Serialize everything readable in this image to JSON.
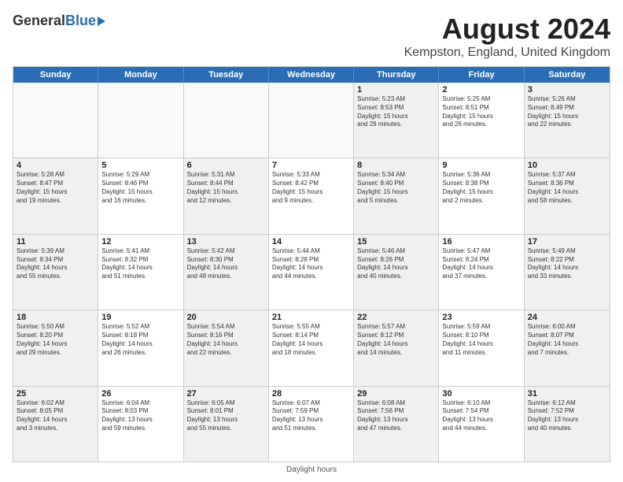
{
  "header": {
    "logo_general": "General",
    "logo_blue": "Blue",
    "main_title": "August 2024",
    "subtitle": "Kempston, England, United Kingdom"
  },
  "footer": {
    "note": "Daylight hours"
  },
  "days_of_week": [
    "Sunday",
    "Monday",
    "Tuesday",
    "Wednesday",
    "Thursday",
    "Friday",
    "Saturday"
  ],
  "weeks": [
    [
      {
        "day": "",
        "info": ""
      },
      {
        "day": "",
        "info": ""
      },
      {
        "day": "",
        "info": ""
      },
      {
        "day": "",
        "info": ""
      },
      {
        "day": "1",
        "info": "Sunrise: 5:23 AM\nSunset: 8:53 PM\nDaylight: 15 hours\nand 29 minutes."
      },
      {
        "day": "2",
        "info": "Sunrise: 5:25 AM\nSunset: 8:51 PM\nDaylight: 15 hours\nand 26 minutes."
      },
      {
        "day": "3",
        "info": "Sunrise: 5:26 AM\nSunset: 8:49 PM\nDaylight: 15 hours\nand 22 minutes."
      }
    ],
    [
      {
        "day": "4",
        "info": "Sunrise: 5:28 AM\nSunset: 8:47 PM\nDaylight: 15 hours\nand 19 minutes."
      },
      {
        "day": "5",
        "info": "Sunrise: 5:29 AM\nSunset: 8:46 PM\nDaylight: 15 hours\nand 16 minutes."
      },
      {
        "day": "6",
        "info": "Sunrise: 5:31 AM\nSunset: 8:44 PM\nDaylight: 15 hours\nand 12 minutes."
      },
      {
        "day": "7",
        "info": "Sunrise: 5:33 AM\nSunset: 8:42 PM\nDaylight: 15 hours\nand 9 minutes."
      },
      {
        "day": "8",
        "info": "Sunrise: 5:34 AM\nSunset: 8:40 PM\nDaylight: 15 hours\nand 5 minutes."
      },
      {
        "day": "9",
        "info": "Sunrise: 5:36 AM\nSunset: 8:38 PM\nDaylight: 15 hours\nand 2 minutes."
      },
      {
        "day": "10",
        "info": "Sunrise: 5:37 AM\nSunset: 8:36 PM\nDaylight: 14 hours\nand 58 minutes."
      }
    ],
    [
      {
        "day": "11",
        "info": "Sunrise: 5:39 AM\nSunset: 8:34 PM\nDaylight: 14 hours\nand 55 minutes."
      },
      {
        "day": "12",
        "info": "Sunrise: 5:41 AM\nSunset: 8:32 PM\nDaylight: 14 hours\nand 51 minutes."
      },
      {
        "day": "13",
        "info": "Sunrise: 5:42 AM\nSunset: 8:30 PM\nDaylight: 14 hours\nand 48 minutes."
      },
      {
        "day": "14",
        "info": "Sunrise: 5:44 AM\nSunset: 8:28 PM\nDaylight: 14 hours\nand 44 minutes."
      },
      {
        "day": "15",
        "info": "Sunrise: 5:46 AM\nSunset: 8:26 PM\nDaylight: 14 hours\nand 40 minutes."
      },
      {
        "day": "16",
        "info": "Sunrise: 5:47 AM\nSunset: 8:24 PM\nDaylight: 14 hours\nand 37 minutes."
      },
      {
        "day": "17",
        "info": "Sunrise: 5:49 AM\nSunset: 8:22 PM\nDaylight: 14 hours\nand 33 minutes."
      }
    ],
    [
      {
        "day": "18",
        "info": "Sunrise: 5:50 AM\nSunset: 8:20 PM\nDaylight: 14 hours\nand 29 minutes."
      },
      {
        "day": "19",
        "info": "Sunrise: 5:52 AM\nSunset: 8:18 PM\nDaylight: 14 hours\nand 26 minutes."
      },
      {
        "day": "20",
        "info": "Sunrise: 5:54 AM\nSunset: 8:16 PM\nDaylight: 14 hours\nand 22 minutes."
      },
      {
        "day": "21",
        "info": "Sunrise: 5:55 AM\nSunset: 8:14 PM\nDaylight: 14 hours\nand 18 minutes."
      },
      {
        "day": "22",
        "info": "Sunrise: 5:57 AM\nSunset: 8:12 PM\nDaylight: 14 hours\nand 14 minutes."
      },
      {
        "day": "23",
        "info": "Sunrise: 5:59 AM\nSunset: 8:10 PM\nDaylight: 14 hours\nand 11 minutes."
      },
      {
        "day": "24",
        "info": "Sunrise: 6:00 AM\nSunset: 8:07 PM\nDaylight: 14 hours\nand 7 minutes."
      }
    ],
    [
      {
        "day": "25",
        "info": "Sunrise: 6:02 AM\nSunset: 8:05 PM\nDaylight: 14 hours\nand 3 minutes."
      },
      {
        "day": "26",
        "info": "Sunrise: 6:04 AM\nSunset: 8:03 PM\nDaylight: 13 hours\nand 59 minutes."
      },
      {
        "day": "27",
        "info": "Sunrise: 6:05 AM\nSunset: 8:01 PM\nDaylight: 13 hours\nand 55 minutes."
      },
      {
        "day": "28",
        "info": "Sunrise: 6:07 AM\nSunset: 7:59 PM\nDaylight: 13 hours\nand 51 minutes."
      },
      {
        "day": "29",
        "info": "Sunrise: 6:08 AM\nSunset: 7:56 PM\nDaylight: 13 hours\nand 47 minutes."
      },
      {
        "day": "30",
        "info": "Sunrise: 6:10 AM\nSunset: 7:54 PM\nDaylight: 13 hours\nand 44 minutes."
      },
      {
        "day": "31",
        "info": "Sunrise: 6:12 AM\nSunset: 7:52 PM\nDaylight: 13 hours\nand 40 minutes."
      }
    ]
  ]
}
